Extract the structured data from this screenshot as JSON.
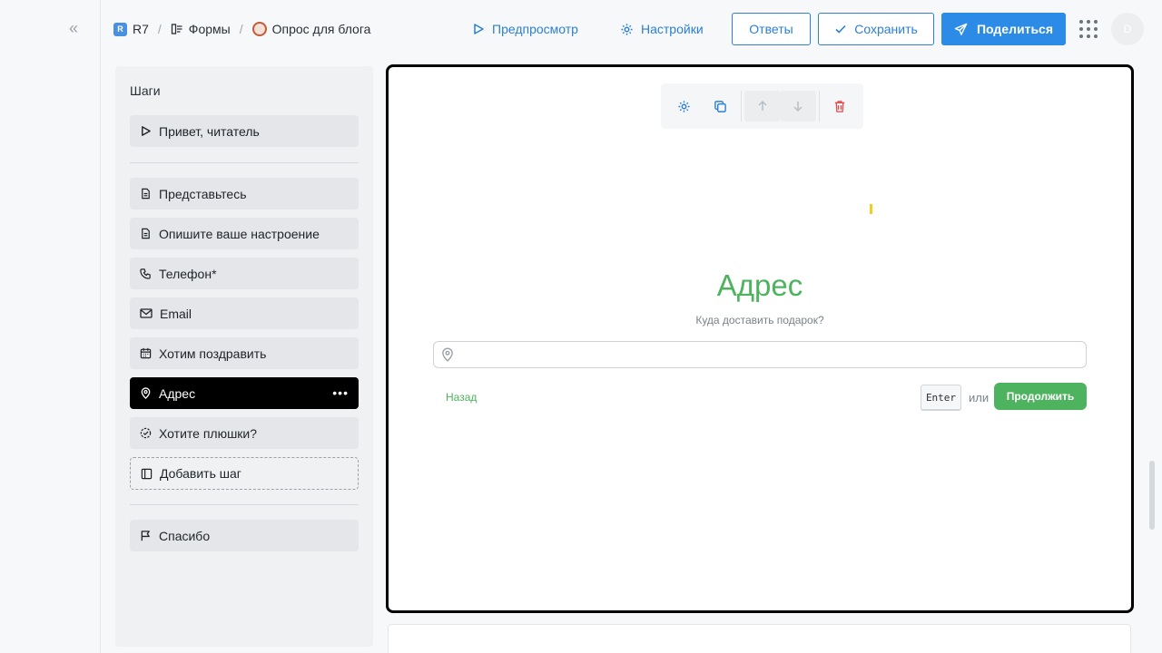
{
  "breadcrumb": {
    "workspace_badge": "R",
    "workspace": "R7",
    "section": "Формы",
    "form": "Опрос для блога"
  },
  "header": {
    "preview_label": "Предпросмотр",
    "settings_label": "Настройки",
    "responses_label": "Ответы",
    "save_label": "Сохранить",
    "share_label": "Поделиться",
    "avatar_initial": "D"
  },
  "steps": {
    "title": "Шаги",
    "welcome": "Привет, читатель",
    "items": [
      {
        "label": "Представьтесь",
        "icon": "document-icon"
      },
      {
        "label": "Опишите ваше настроение",
        "icon": "document-icon"
      },
      {
        "label": "Телефон*",
        "icon": "phone-icon"
      },
      {
        "label": "Email",
        "icon": "mail-icon"
      },
      {
        "label": "Хотим поздравить",
        "icon": "calendar-icon"
      },
      {
        "label": "Адрес",
        "icon": "location-pin-icon",
        "active": true
      },
      {
        "label": "Хотите плюшки?",
        "icon": "check-circle-icon"
      }
    ],
    "add_step": "Добавить шаг",
    "final": "Спасибо"
  },
  "question": {
    "title": "Адрес",
    "subtitle": "Куда доставить подарок?",
    "input_value": "",
    "back_label": "Назад",
    "enter_key": "Enter",
    "or_label": "или",
    "continue_label": "Продолжить"
  },
  "colors": {
    "accent_blue": "#2b8be6",
    "success_green": "#4db35e",
    "danger_red": "#e5484d",
    "active_step": "#000000"
  }
}
